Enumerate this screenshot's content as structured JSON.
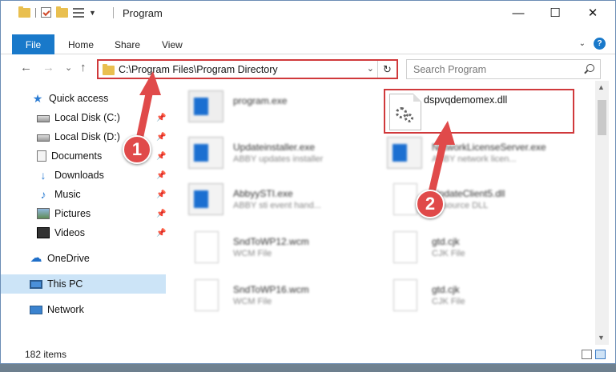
{
  "window": {
    "title": "Program",
    "controls": {
      "minimize": "—",
      "maximize": "☐",
      "close": "✕"
    }
  },
  "ribbon": {
    "file_tab": "File",
    "tabs": [
      "Home",
      "Share",
      "View"
    ],
    "help": "?"
  },
  "navigation": {
    "back": "←",
    "forward": "→",
    "recent": "⌄",
    "up": "↑",
    "address": "C:\\Program Files\\Program Directory",
    "address_dropdown": "⌄",
    "refresh": "↻",
    "search_placeholder": "Search Program"
  },
  "sidebar": {
    "items": [
      {
        "label": "Quick access",
        "icon": "star-icon",
        "pinned": false
      },
      {
        "label": "Local Disk (C:)",
        "icon": "disk-icon",
        "pinned": true
      },
      {
        "label": "Local Disk (D:)",
        "icon": "disk-icon",
        "pinned": true
      },
      {
        "label": "Documents",
        "icon": "documents-icon",
        "pinned": true
      },
      {
        "label": "Downloads",
        "icon": "downloads-icon",
        "pinned": true
      },
      {
        "label": "Music",
        "icon": "music-icon",
        "pinned": true
      },
      {
        "label": "Pictures",
        "icon": "pictures-icon",
        "pinned": true
      },
      {
        "label": "Videos",
        "icon": "videos-icon",
        "pinned": true
      },
      {
        "label": "OneDrive",
        "icon": "cloud-icon",
        "pinned": false
      },
      {
        "label": "This PC",
        "icon": "computer-icon",
        "pinned": false,
        "selected": true
      },
      {
        "label": "Network",
        "icon": "network-icon",
        "pinned": false
      }
    ],
    "pin_glyph": "📌"
  },
  "files": [
    {
      "name": "program.exe",
      "desc": "",
      "thumb": "app"
    },
    {
      "name": "Updateinstaller.exe",
      "desc": "ABBY updates installer",
      "thumb": "app"
    },
    {
      "name": "NetworkLicenseServer.exe",
      "desc": "ABBY network licen...",
      "thumb": "app"
    },
    {
      "name": "AbbyySTI.exe",
      "desc": "ABBY sti event hand...",
      "thumb": "app"
    },
    {
      "name": "UpdateClient5.dll",
      "desc": "Resource DLL",
      "thumb": "gear"
    },
    {
      "name": "SndToWP12.wcm",
      "desc": "WCM File",
      "thumb": "doc"
    },
    {
      "name": "gtd.cjk",
      "desc": "CJK File",
      "thumb": "doc"
    },
    {
      "name": "SndToWP16.wcm",
      "desc": "WCM File",
      "thumb": "doc"
    },
    {
      "name": "gtd.cjk",
      "desc": "CJK File",
      "thumb": "doc"
    }
  ],
  "highlighted_file": {
    "name": "dspvqdemomex.dll"
  },
  "annotations": {
    "step1": "1",
    "step2": "2",
    "accent": "#e04a4a"
  },
  "status": {
    "item_count": "182 items"
  }
}
